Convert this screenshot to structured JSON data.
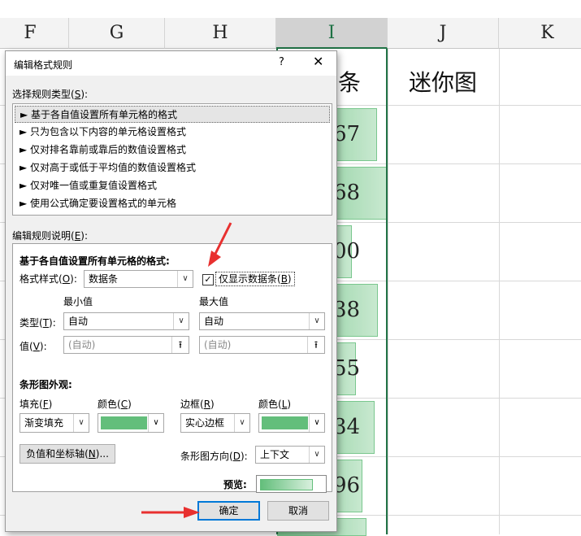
{
  "sheet": {
    "columns": [
      "F",
      "G",
      "H",
      "I",
      "J",
      "K"
    ],
    "cells": {
      "data_bar_header": "数据条",
      "sparkline_header": "迷你图"
    },
    "bar_values": [
      "67",
      "68",
      "00",
      "38",
      "55",
      "34",
      "96"
    ]
  },
  "dialog": {
    "title": "编辑格式规则",
    "help": "?",
    "close": "✕",
    "select_rule_type": {
      "text": "选择规则类型(",
      "key": "S",
      "tail": "):"
    },
    "rule_types": [
      "► 基于各自值设置所有单元格的格式",
      "► 只为包含以下内容的单元格设置格式",
      "► 仅对排名靠前或靠后的数值设置格式",
      "► 仅对高于或低于平均值的数值设置格式",
      "► 仅对唯一值或重复值设置格式",
      "► 使用公式确定要设置格式的单元格"
    ],
    "edit_rule_desc": {
      "text": "编辑规则说明(",
      "key": "E",
      "tail": "):"
    },
    "format_all_cells": "基于各自值设置所有单元格的格式:",
    "format_style_label": {
      "text": "格式样式(",
      "key": "O",
      "tail": "):"
    },
    "format_style_value": "数据条",
    "show_bar_only": {
      "text": "仅显示数据条(",
      "key": "B",
      "tail": ")",
      "checked": "✓"
    },
    "min_label": "最小值",
    "max_label": "最大值",
    "type_label": {
      "text": "类型(",
      "key": "T",
      "tail": "):"
    },
    "value_label": {
      "text": "值(",
      "key": "V",
      "tail": "):"
    },
    "min_type": "自动",
    "max_type": "自动",
    "min_value": "(自动)",
    "max_value": "(自动)",
    "bar_appearance": "条形图外观:",
    "fill_label": {
      "text": "填充(",
      "key": "F",
      "tail": ")"
    },
    "color_label_1": {
      "text": "颜色(",
      "key": "C",
      "tail": ")"
    },
    "border_label": {
      "text": "边框(",
      "key": "R",
      "tail": ")"
    },
    "color_label_2": {
      "text": "颜色(",
      "key": "L",
      "tail": ")"
    },
    "fill_value": "渐变填充",
    "border_value": "实心边框",
    "negative_axis_button": {
      "text": "负值和坐标轴(",
      "key": "N",
      "tail": ")..."
    },
    "bar_direction_label": {
      "text": "条形图方向(",
      "key": "D",
      "tail": "):"
    },
    "bar_direction_value": "上下文",
    "preview_label": "预览:",
    "ok_button": "确定",
    "cancel_button": "取消"
  },
  "colors": {
    "bar_green": "#63be7b",
    "arrow_red": "#e8302f",
    "focus_blue": "#0078d7"
  }
}
